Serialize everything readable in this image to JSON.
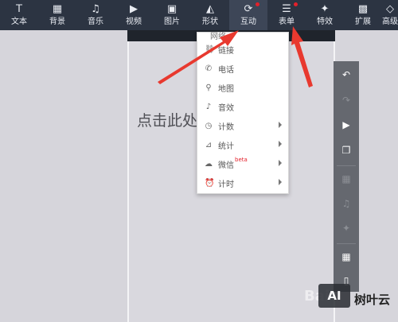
{
  "toolbar": {
    "items": [
      {
        "label": "文本",
        "icon": "text-icon"
      },
      {
        "label": "背景",
        "icon": "grid-icon"
      },
      {
        "label": "音乐",
        "icon": "music-icon"
      },
      {
        "label": "视频",
        "icon": "video-icon"
      },
      {
        "label": "图片",
        "icon": "image-icon"
      },
      {
        "label": "形状",
        "icon": "shape-icon"
      },
      {
        "label": "互动",
        "icon": "refresh-icon"
      },
      {
        "label": "表单",
        "icon": "list-icon"
      },
      {
        "label": "特效",
        "icon": "pin-icon"
      },
      {
        "label": "扩展",
        "icon": "apps-icon"
      },
      {
        "label": "高级",
        "icon": "diamond-icon"
      }
    ]
  },
  "canvas": {
    "hint": "点击此处"
  },
  "dropdown": {
    "top_label": "网络",
    "items": [
      {
        "label": "链接",
        "icon": "link-icon",
        "submenu": false
      },
      {
        "label": "电话",
        "icon": "phone-icon",
        "submenu": false
      },
      {
        "label": "地图",
        "icon": "map-pin-icon",
        "submenu": false
      },
      {
        "label": "音效",
        "icon": "sound-icon",
        "submenu": false
      },
      {
        "label": "计数",
        "icon": "clock-icon",
        "submenu": true
      },
      {
        "label": "统计",
        "icon": "chart-icon",
        "submenu": true
      },
      {
        "label": "微信",
        "icon": "wechat-icon",
        "submenu": true,
        "badge": "beta"
      },
      {
        "label": "计时",
        "icon": "alarm-icon",
        "submenu": true
      }
    ]
  },
  "watermark": {
    "logo": "AI",
    "text": "树叶云",
    "baidu": "Bai"
  }
}
